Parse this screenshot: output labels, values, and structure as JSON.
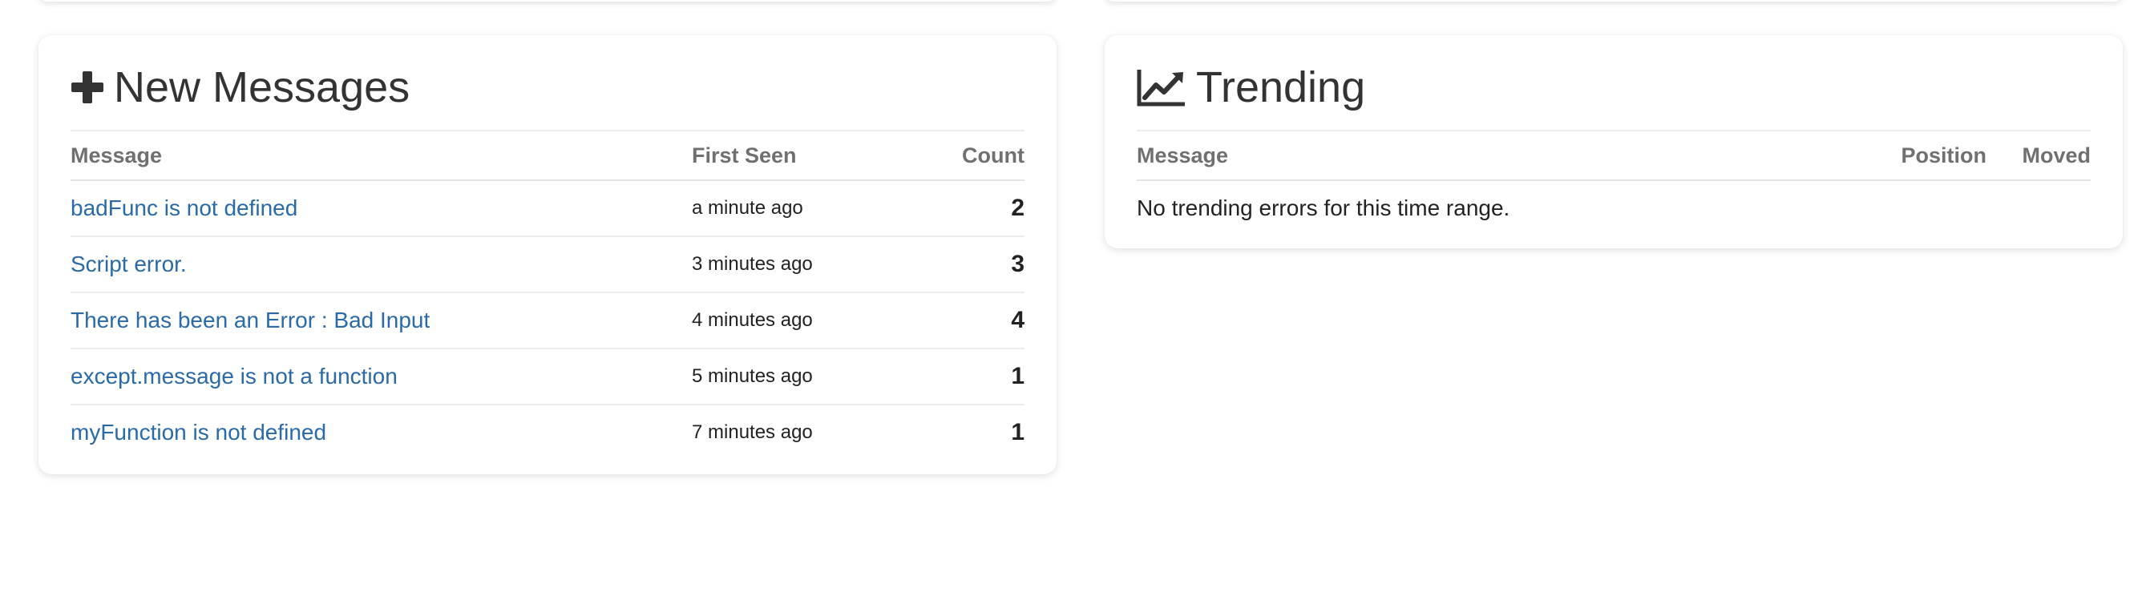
{
  "new_messages": {
    "title": "New Messages",
    "icon": "plus-icon",
    "columns": {
      "message": "Message",
      "first_seen": "First Seen",
      "count": "Count"
    },
    "rows": [
      {
        "message": "badFunc is not defined",
        "first_seen": "a minute ago",
        "count": "2"
      },
      {
        "message": "Script error.",
        "first_seen": "3 minutes ago",
        "count": "3"
      },
      {
        "message": "There has been an Error : Bad Input",
        "first_seen": "4 minutes ago",
        "count": "4"
      },
      {
        "message": "except.message is not a function",
        "first_seen": "5 minutes ago",
        "count": "1"
      },
      {
        "message": "myFunction is not defined",
        "first_seen": "7 minutes ago",
        "count": "1"
      }
    ]
  },
  "trending": {
    "title": "Trending",
    "icon": "line-chart-icon",
    "columns": {
      "message": "Message",
      "position": "Position",
      "moved": "Moved"
    },
    "empty_text": "No trending errors for this time range."
  },
  "colors": {
    "link": "#2a6aa8",
    "title": "#333333",
    "header_text": "#707070"
  }
}
